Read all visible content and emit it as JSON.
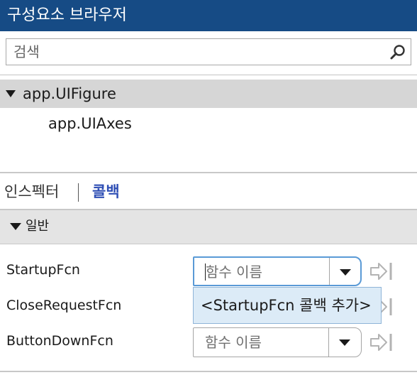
{
  "window": {
    "title": "구성요소 브라우저"
  },
  "search": {
    "placeholder": "검색",
    "value": ""
  },
  "tree": {
    "root": "app.UIFigure",
    "children": [
      "app.UIAxes"
    ]
  },
  "tabs": {
    "inspector": "인스펙터",
    "callbacks": "콜백",
    "active": "콜백"
  },
  "section": {
    "title": "일반"
  },
  "properties": [
    {
      "label": "StartupFcn",
      "value": "함수 이름"
    },
    {
      "label": "CloseRequestFcn",
      "value": "함수 이름"
    },
    {
      "label": "ButtonDownFcn",
      "value": "함수 이름"
    }
  ],
  "dropdown": {
    "option": "<StartupFcn 콜백 추가>"
  },
  "colors": {
    "title_bar": "#164b85",
    "active_tab": "#2f4fb5",
    "dropdown_bg": "#dcebf7",
    "focus": "#5a9ad6"
  }
}
